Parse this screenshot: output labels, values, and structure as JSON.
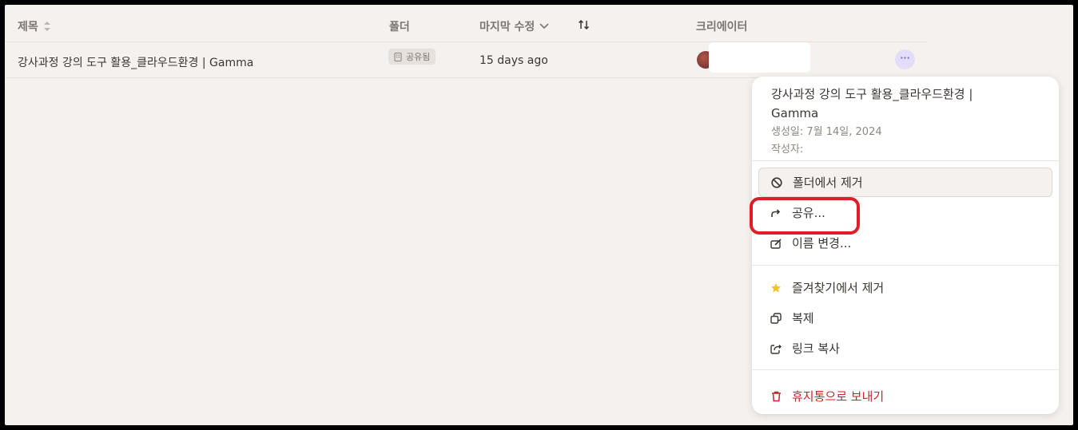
{
  "header": {
    "col_title": "제목",
    "col_folder": "폴더",
    "col_modified": "마지막 수정",
    "col_creator": "크리에이터"
  },
  "row": {
    "title": "강사과정 강의 도구 활용_클라우드환경 | Gamma",
    "folder_chip": "공유됨",
    "modified": "15 days ago",
    "more": "···"
  },
  "menu": {
    "title": "강사과정 강의 도구 활용_클라우드환경 | Gamma",
    "created": "생성일: 7월 14일, 2024",
    "author": "작성자:",
    "items": {
      "remove_folder": "폴더에서 제거",
      "share": "공유...",
      "rename": "이름 변경...",
      "unfavorite": "즐겨찾기에서 제거",
      "duplicate": "복제",
      "copy_link": "링크 복사",
      "trash": "휴지통으로 보내기"
    }
  },
  "colors": {
    "accent_purple": "#7b66c9",
    "danger": "#c8232c",
    "highlight": "#e01e2b",
    "star": "#f1c232"
  }
}
